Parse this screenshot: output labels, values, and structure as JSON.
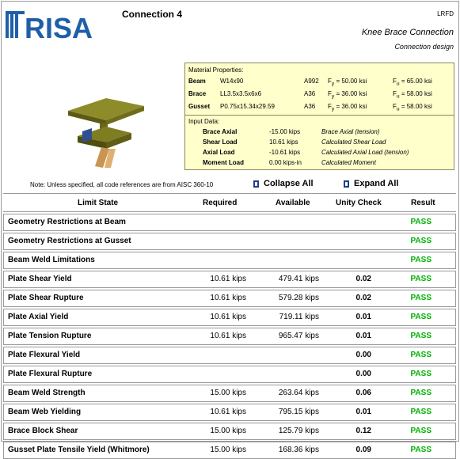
{
  "header": {
    "brand": "RISA",
    "connection_title": "Connection 4",
    "code": "LRFD",
    "connection_type": "Knee Brace Connection",
    "design_label": "Connection design"
  },
  "material": {
    "heading": "Material Properties:",
    "rows": [
      {
        "part": "Beam",
        "section": "W14x90",
        "grade": "A992",
        "fy": "F<sub>y</sub> = 50.00 ksi",
        "fu": "F<sub>u</sub> = 65.00 ksi"
      },
      {
        "part": "Brace",
        "section": "LL3.5x3.5x6x6",
        "grade": "A36",
        "fy": "F<sub>y</sub> = 36.00 ksi",
        "fu": "F<sub>u</sub> = 58.00 ksi"
      },
      {
        "part": "Gusset",
        "section": "P0.75x15.34x29.59",
        "grade": "A36",
        "fy": "F<sub>y</sub> = 36.00 ksi",
        "fu": "F<sub>u</sub> = 58.00 ksi"
      }
    ]
  },
  "input": {
    "heading": "Input Data:",
    "rows": [
      {
        "label": "Brace Axial",
        "value": "-15.00 kips",
        "desc": "Brace Axial (tension)"
      },
      {
        "label": "Shear Load",
        "value": "10.61 kips",
        "desc": "Calculated Shear Load"
      },
      {
        "label": "Axial Load",
        "value": "-10.61 kips",
        "desc": "Calculated Axial Load (tension)"
      },
      {
        "label": "Moment Load",
        "value": "0.00 kips-in",
        "desc": "Calculated Moment"
      }
    ]
  },
  "note": "Note: Unless specified, all code references are from AISC 360-10",
  "controls": {
    "collapse": "Collapse All",
    "expand": "Expand All"
  },
  "colors": {
    "pass": "#00b000",
    "brand": "#1f5fa8",
    "info_bg": "#ffffcc"
  },
  "table": {
    "headers": [
      "Limit State",
      "Required",
      "Available",
      "Unity Check",
      "Result"
    ],
    "rows": [
      {
        "limit": "Geometry Restrictions at Beam",
        "required": "",
        "available": "",
        "unity": "",
        "result": "PASS"
      },
      {
        "limit": "Geometry Restrictions at Gusset",
        "required": "",
        "available": "",
        "unity": "",
        "result": "PASS"
      },
      {
        "limit": "Beam Weld Limitations",
        "required": "",
        "available": "",
        "unity": "",
        "result": "PASS"
      },
      {
        "limit": "Plate Shear Yield",
        "required": "10.61 kips",
        "available": "479.41 kips",
        "unity": "0.02",
        "result": "PASS"
      },
      {
        "limit": "Plate Shear Rupture",
        "required": "10.61 kips",
        "available": "579.28 kips",
        "unity": "0.02",
        "result": "PASS"
      },
      {
        "limit": "Plate Axial Yield",
        "required": "10.61 kips",
        "available": "719.11 kips",
        "unity": "0.01",
        "result": "PASS"
      },
      {
        "limit": "Plate Tension Rupture",
        "required": "10.61 kips",
        "available": "965.47 kips",
        "unity": "0.01",
        "result": "PASS"
      },
      {
        "limit": "Plate Flexural Yield",
        "required": "",
        "available": "",
        "unity": "0.00",
        "result": "PASS"
      },
      {
        "limit": "Plate Flexural Rupture",
        "required": "",
        "available": "",
        "unity": "0.00",
        "result": "PASS"
      },
      {
        "limit": "Beam Weld Strength",
        "required": "15.00 kips",
        "available": "263.64 kips",
        "unity": "0.06",
        "result": "PASS"
      },
      {
        "limit": "Beam Web Yielding",
        "required": "10.61 kips",
        "available": "795.15 kips",
        "unity": "0.01",
        "result": "PASS"
      },
      {
        "limit": "Brace Block Shear",
        "required": "15.00 kips",
        "available": "125.79 kips",
        "unity": "0.12",
        "result": "PASS"
      },
      {
        "limit": "Gusset Plate Tensile Yield (Whitmore)",
        "required": "15.00 kips",
        "available": "168.36 kips",
        "unity": "0.09",
        "result": "PASS"
      }
    ]
  }
}
